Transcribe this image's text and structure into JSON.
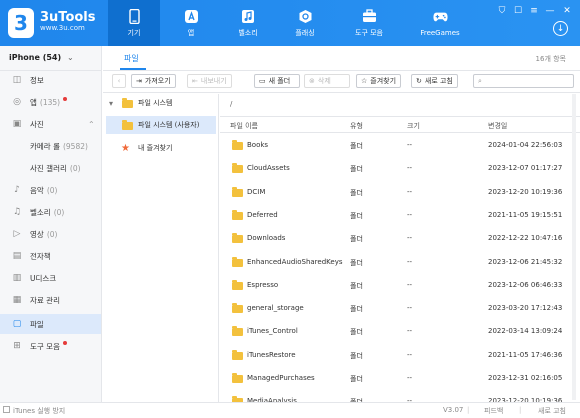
{
  "app": {
    "name": "3uTools",
    "url": "www.3u.com",
    "logo_digit": "3"
  },
  "nav": {
    "tabs": [
      {
        "label": "기기",
        "icon": "device-icon",
        "active": true
      },
      {
        "label": "앱",
        "icon": "apps-icon",
        "active": false
      },
      {
        "label": "벨소리",
        "icon": "ringtone-icon",
        "active": false
      },
      {
        "label": "플래싱",
        "icon": "flash-icon",
        "active": false
      },
      {
        "label": "도구 모음",
        "icon": "toolbox-icon",
        "active": false
      },
      {
        "label": "FreeGames",
        "icon": "gamepad-icon",
        "active": false
      }
    ]
  },
  "window": {
    "shield": "⛉",
    "shirt": "☐",
    "menu": "≡",
    "minimize": "—",
    "close": "✕",
    "download": "↓"
  },
  "sidebar": {
    "device_name": "iPhone (54)",
    "device_chevron": "⌄",
    "items": [
      {
        "label": "정보",
        "count": "",
        "icon": "info-icon",
        "glyph": "◫"
      },
      {
        "label": "앱",
        "count": "(135)",
        "icon": "apps-icon",
        "glyph": "◎",
        "dot": true
      },
      {
        "label": "사진",
        "count": "",
        "icon": "photos-icon",
        "glyph": "▣",
        "chevron": "⌃"
      },
      {
        "label": "카메라 롤",
        "count": "(9582)",
        "sub": true
      },
      {
        "label": "사진 갤러리",
        "count": "(0)",
        "sub": true
      },
      {
        "label": "음악",
        "count": "(0)",
        "icon": "music-icon",
        "glyph": "♪"
      },
      {
        "label": "벨소리",
        "count": "(0)",
        "icon": "bell-icon",
        "glyph": "♫"
      },
      {
        "label": "영상",
        "count": "(0)",
        "icon": "video-icon",
        "glyph": "▷"
      },
      {
        "label": "전자책",
        "count": "",
        "icon": "book-icon",
        "glyph": "▤"
      },
      {
        "label": "U디스크",
        "count": "",
        "icon": "udisk-icon",
        "glyph": "▥"
      },
      {
        "label": "자료 관리",
        "count": "",
        "icon": "data-icon",
        "glyph": "▦"
      },
      {
        "label": "파일",
        "count": "",
        "icon": "file-icon",
        "glyph": "▢",
        "active": true
      },
      {
        "label": "도구 모음",
        "count": "",
        "icon": "tools-icon",
        "glyph": "⊞",
        "dot": true
      }
    ]
  },
  "content": {
    "tab": "파일",
    "file_count": "16개 항목",
    "toolbar": {
      "back": "‹",
      "import": "가져오기",
      "export": "내보내기",
      "new_folder": "새 폴더",
      "delete": "삭제",
      "favorite": "즐겨찾기",
      "refresh": "새로 고침",
      "search_placeholder": ""
    },
    "tree": {
      "root": "파일 시스템",
      "user": "파일 시스템 (사용자)",
      "favorites": "내 즐겨찾기",
      "expand": "▾"
    },
    "path": "/",
    "columns": {
      "name": "파일 이름",
      "type": "유형",
      "size": "크기",
      "modified": "변경일"
    },
    "rows": [
      {
        "name": "Books",
        "type": "폴더",
        "size": "--",
        "modified": "2024-01-04 22:56:03"
      },
      {
        "name": "CloudAssets",
        "type": "폴더",
        "size": "--",
        "modified": "2023-12-07 01:17:27"
      },
      {
        "name": "DCIM",
        "type": "폴더",
        "size": "--",
        "modified": "2023-12-20 10:19:36"
      },
      {
        "name": "Deferred",
        "type": "폴더",
        "size": "--",
        "modified": "2021-11-05 19:15:51"
      },
      {
        "name": "Downloads",
        "type": "폴더",
        "size": "--",
        "modified": "2022-12-22 10:47:16"
      },
      {
        "name": "EnhancedAudioSharedKeys",
        "type": "폴더",
        "size": "--",
        "modified": "2023-12-06 21:45:32"
      },
      {
        "name": "Espresso",
        "type": "폴더",
        "size": "--",
        "modified": "2023-12-06 06:46:33"
      },
      {
        "name": "general_storage",
        "type": "폴더",
        "size": "--",
        "modified": "2023-03-20 17:12:43"
      },
      {
        "name": "iTunes_Control",
        "type": "폴더",
        "size": "--",
        "modified": "2022-03-14 13:09:24"
      },
      {
        "name": "iTunesRestore",
        "type": "폴더",
        "size": "--",
        "modified": "2021-11-05 17:46:36"
      },
      {
        "name": "ManagedPurchases",
        "type": "폴더",
        "size": "--",
        "modified": "2023-12-31 02:16:05"
      },
      {
        "name": "MediaAnalysis",
        "type": "폴더",
        "size": "--",
        "modified": "2023-12-20 10:19:36"
      }
    ]
  },
  "status": {
    "itunes_block": "iTunes 실행 방지",
    "version": "V3.07",
    "feedback": "피드백",
    "update": "새로 고침",
    "dot_sep": "|"
  },
  "colors": {
    "accent": "#1f86ec",
    "folder": "#f3c13d",
    "selected": "#dce9fb",
    "dot": "#e53b3b"
  }
}
